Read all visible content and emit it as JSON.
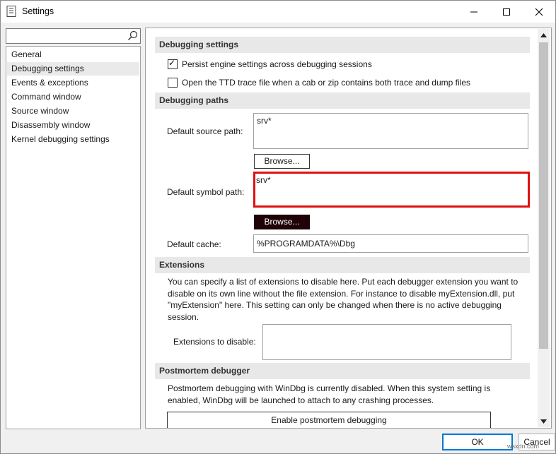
{
  "window": {
    "title": "Settings"
  },
  "search": {
    "value": "",
    "placeholder": ""
  },
  "nav": {
    "items": [
      {
        "label": "General"
      },
      {
        "label": "Debugging settings"
      },
      {
        "label": "Events & exceptions"
      },
      {
        "label": "Command window"
      },
      {
        "label": "Source window"
      },
      {
        "label": "Disassembly window"
      },
      {
        "label": "Kernel debugging settings"
      }
    ],
    "selected": "Debugging settings"
  },
  "sections": {
    "debugging_settings": {
      "header": "Debugging settings",
      "persist_label": "Persist engine settings across debugging sessions",
      "persist_checked": true,
      "ttd_label": "Open the TTD trace file when a cab or zip contains both trace and dump files",
      "ttd_checked": false
    },
    "debugging_paths": {
      "header": "Debugging paths",
      "source_path_label": "Default source path:",
      "source_path_value": "srv*",
      "browse_label": "Browse...",
      "symbol_path_label": "Default symbol path:",
      "symbol_path_value": "srv*",
      "cache_label": "Default cache:",
      "cache_value": "%PROGRAMDATA%\\Dbg"
    },
    "extensions": {
      "header": "Extensions",
      "description": "You can specify a list of extensions to disable here. Put each debugger extension you want to disable on its own line without the file extension. For instance to disable myExtension.dll, put \"myExtension\" here. This setting can only be changed when there is no active debugging session.",
      "disable_label": "Extensions to disable:",
      "disable_value": ""
    },
    "postmortem": {
      "header": "Postmortem debugger",
      "description": "Postmortem debugging with WinDbg is currently disabled. When this system setting is enabled, WinDbg will be launched to attach to any crashing processes.",
      "enable_label": "Enable postmortem debugging"
    }
  },
  "footer": {
    "ok_label": "OK",
    "cancel_label": "Cancel"
  },
  "watermark": "wsxdn.com",
  "colors": {
    "highlight": "#e01010",
    "ok_border": "#0078d4",
    "dark_button": "#1f0307"
  }
}
